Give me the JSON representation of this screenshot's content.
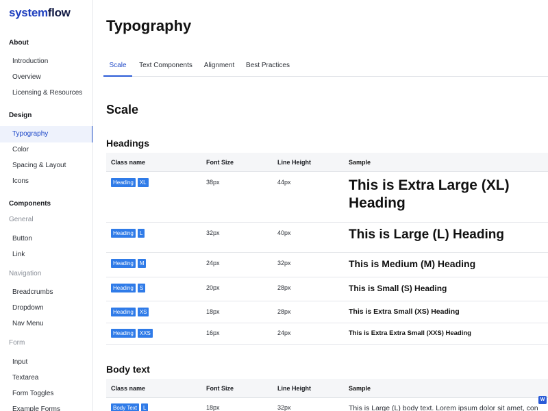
{
  "logo": {
    "part1": "system",
    "part2": "flow"
  },
  "sidebar": {
    "about": {
      "title": "About",
      "items": [
        "Introduction",
        "Overview",
        "Licensing & Resources"
      ]
    },
    "design": {
      "title": "Design",
      "items": [
        "Typography",
        "Color",
        "Spacing & Layout",
        "Icons"
      ],
      "active_item": "Typography"
    },
    "components": {
      "title": "Components",
      "general": {
        "title": "General",
        "items": [
          "Button",
          "Link"
        ]
      },
      "navigation": {
        "title": "Navigation",
        "items": [
          "Breadcrumbs",
          "Dropdown",
          "Nav Menu"
        ]
      },
      "form": {
        "title": "Form",
        "items": [
          "Input",
          "Textarea",
          "Form Toggles",
          "Example Forms"
        ]
      }
    }
  },
  "page": {
    "title": "Typography"
  },
  "tabs": [
    {
      "label": "Scale",
      "active": true
    },
    {
      "label": "Text Components",
      "active": false
    },
    {
      "label": "Alignment",
      "active": false
    },
    {
      "label": "Best Practices",
      "active": false
    }
  ],
  "content": {
    "section_title": "Scale",
    "headings": {
      "title": "Headings",
      "columns": [
        "Class name",
        "Font Size",
        "Line Height",
        "Sample"
      ],
      "rows": [
        {
          "badge1": "Heading",
          "badge2": "XL",
          "size": "38px",
          "line": "44px",
          "sample": "This is Extra Large (XL) Heading"
        },
        {
          "badge1": "Heading",
          "badge2": "L",
          "size": "32px",
          "line": "40px",
          "sample": "This is Large (L) Heading"
        },
        {
          "badge1": "Heading",
          "badge2": "M",
          "size": "24px",
          "line": "32px",
          "sample": "This is Medium (M) Heading"
        },
        {
          "badge1": "Heading",
          "badge2": "S",
          "size": "20px",
          "line": "28px",
          "sample": "This is Small (S) Heading"
        },
        {
          "badge1": "Heading",
          "badge2": "XS",
          "size": "18px",
          "line": "28px",
          "sample": "This is Extra Small (XS) Heading"
        },
        {
          "badge1": "Heading",
          "badge2": "XXS",
          "size": "16px",
          "line": "24px",
          "sample": "This is Extra Extra Small (XXS) Heading"
        }
      ]
    },
    "body_text": {
      "title": "Body text",
      "columns": [
        "Class name",
        "Font Size",
        "Line Height",
        "Sample"
      ],
      "rows": [
        {
          "badge1": "Body Text",
          "badge2": "L",
          "size": "18px",
          "line": "32px",
          "sample": "This is Large (L) body text. Lorem ipsum dolor sit amet, con"
        }
      ]
    }
  },
  "corner_badge": "W",
  "colors": {
    "accent": "#2a5bd7",
    "badge": "#2f7be8",
    "active_bg": "#eef2fc"
  }
}
